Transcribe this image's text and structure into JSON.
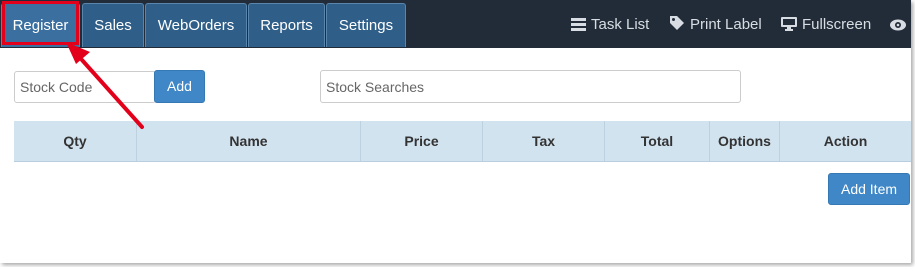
{
  "nav": {
    "tabs": [
      {
        "label": "Register",
        "active": true
      },
      {
        "label": "Sales"
      },
      {
        "label": "WebOrders"
      },
      {
        "label": "Reports"
      },
      {
        "label": "Settings"
      }
    ],
    "right_links": [
      {
        "label": "Task List",
        "icon": "list-icon"
      },
      {
        "label": "Print Label",
        "icon": "tag-icon"
      },
      {
        "label": "Fullscreen",
        "icon": "monitor-icon"
      },
      {
        "label": "",
        "icon": "eye-icon"
      }
    ]
  },
  "stock_code": {
    "placeholder": "Stock Code",
    "value": ""
  },
  "add_label": "Add",
  "stock_search": {
    "placeholder": "Stock Searches",
    "value": ""
  },
  "table": {
    "columns": [
      "Qty",
      "Name",
      "Price",
      "Tax",
      "Total",
      "Options",
      "Action"
    ],
    "rows": []
  },
  "add_item_label": "Add Item",
  "colors": {
    "navbar": "#222c38",
    "tab": "#2f5f88",
    "button": "#3f87c7",
    "table_header": "#d2e3f0",
    "annotation": "#e3001b"
  }
}
